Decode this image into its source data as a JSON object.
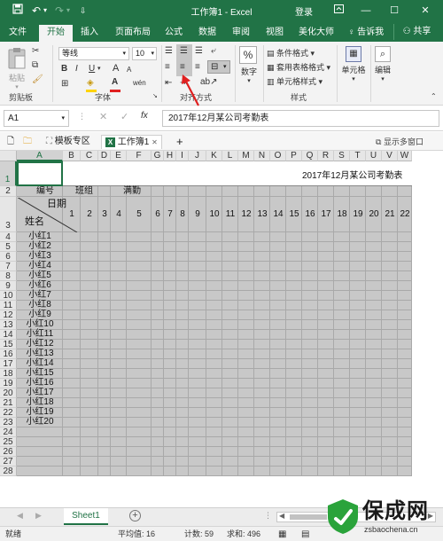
{
  "titlebar": {
    "title": "工作簿1 - Excel",
    "login": "登录"
  },
  "ribbon_tabs": [
    "文件",
    "开始",
    "插入",
    "页面布局",
    "公式",
    "数据",
    "审阅",
    "视图",
    "美化大师",
    "告诉我"
  ],
  "share_label": "共享",
  "ribbon": {
    "paste_label": "粘贴",
    "font_name": "等线",
    "font_size": "10",
    "bold": "B",
    "italic": "I",
    "underline": "U",
    "font_grow": "A",
    "font_shrink": "A",
    "font_color_letter": "A",
    "wen": "wén",
    "number_label": "数字",
    "pct": "%",
    "conditional_format": "条件格式",
    "table_format": "套用表格格式",
    "cell_style": "单元格样式",
    "cells_label": "单元格",
    "edit_label": "编辑",
    "groups": {
      "clipboard": "剪贴板",
      "font": "字体",
      "alignment": "对齐方式",
      "styles": "样式"
    }
  },
  "formula_bar": {
    "name_box": "A1",
    "fx": "fx",
    "formula": "2017年12月某公司考勤表"
  },
  "doc_tabs": {
    "template_zone": "模板专区",
    "workbook": "工作簿1",
    "multi_window": "显示多窗口",
    "add": "+"
  },
  "columns": [
    "A",
    "B",
    "C",
    "D",
    "E",
    "F",
    "G",
    "H",
    "I",
    "J",
    "K",
    "L",
    "M",
    "N",
    "O",
    "P",
    "Q",
    "R",
    "S",
    "T",
    "U",
    "V",
    "W"
  ],
  "rows": [
    "1",
    "2",
    "3",
    "4",
    "5",
    "6",
    "7",
    "8",
    "9",
    "10",
    "11",
    "12",
    "13",
    "14",
    "15",
    "16",
    "17",
    "18",
    "19",
    "20",
    "21",
    "22",
    "23",
    "24",
    "25",
    "26",
    "27",
    "28"
  ],
  "sheet": {
    "title": "2017年12月某公司考勤表",
    "header_number": "编号",
    "header_group": "班组",
    "header_full": "满勤",
    "header_date": "日期",
    "header_name": "姓名",
    "days": [
      "1",
      "2",
      "3",
      "4",
      "5",
      "6",
      "7",
      "8",
      "9",
      "10",
      "11",
      "12",
      "13",
      "14",
      "15",
      "16",
      "17",
      "18",
      "19",
      "20",
      "21",
      "22"
    ],
    "names": [
      "小红1",
      "小红2",
      "小红3",
      "小红4",
      "小红5",
      "小红6",
      "小红7",
      "小红8",
      "小红9",
      "小红10",
      "小红11",
      "小红12",
      "小红13",
      "小红14",
      "小红15",
      "小红16",
      "小红17",
      "小红18",
      "小红19",
      "小红20"
    ]
  },
  "sheet_tabs": {
    "active": "Sheet1",
    "add": "+"
  },
  "status_bar": {
    "ready": "就绪",
    "average": "平均值: 16",
    "count": "计数: 59",
    "sum": "求和: 496"
  },
  "watermark": {
    "text": "保成网",
    "url": "zsbaochena.cn"
  },
  "colors": {
    "excel_green": "#217346",
    "gray_cells": "#c8c8c8",
    "arrow_red": "#e02020"
  }
}
